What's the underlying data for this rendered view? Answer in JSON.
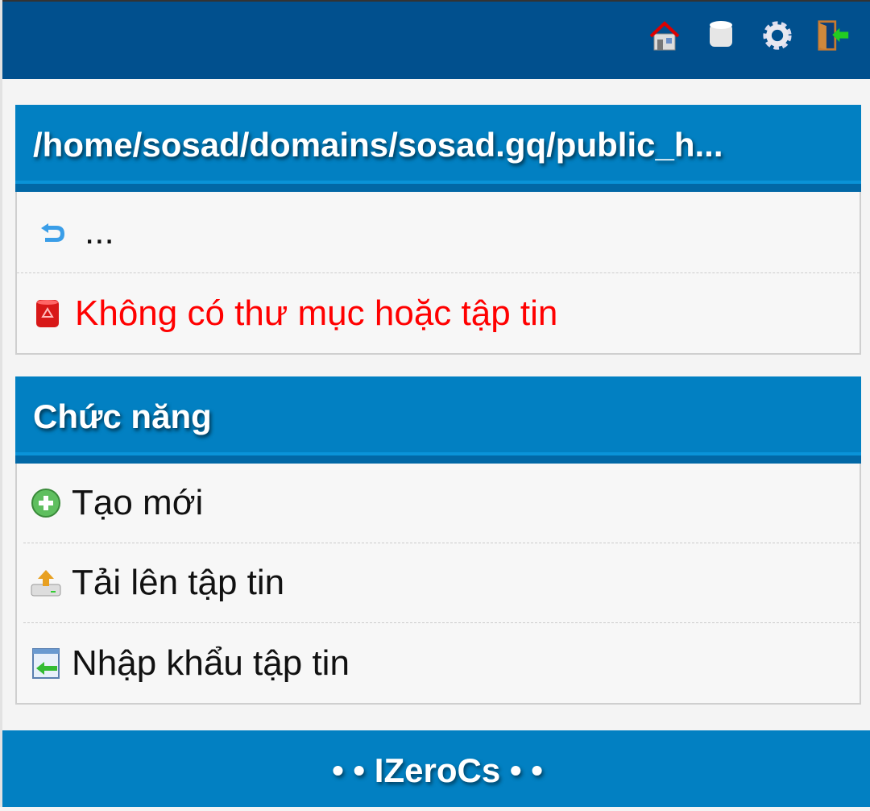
{
  "header": {
    "icons": [
      "home-icon",
      "database-icon",
      "gear-icon",
      "logout-icon"
    ]
  },
  "path_panel": {
    "title": "/home/sosad/domains/sosad.gq/public_h...",
    "parent_label": "...",
    "empty_message": "Không có thư mục hoặc tập tin"
  },
  "functions_panel": {
    "title": "Chức năng",
    "items": [
      {
        "label": "Tạo mới",
        "icon": "add-icon"
      },
      {
        "label": "Tải lên tập tin",
        "icon": "upload-icon"
      },
      {
        "label": "Nhập khẩu tập tin",
        "icon": "import-icon"
      }
    ]
  },
  "footer": {
    "text": "• • IZeroCs • •"
  }
}
